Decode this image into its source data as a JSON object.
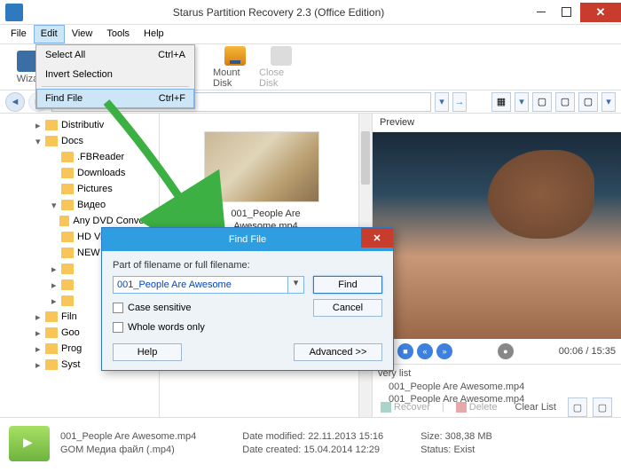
{
  "window": {
    "title": "Starus Partition Recovery 2.3 (Office Edition)"
  },
  "menu": {
    "file": "File",
    "edit": "Edit",
    "view": "View",
    "tools": "Tools",
    "help": "Help"
  },
  "edit_menu": {
    "select_all": "Select All",
    "select_all_sc": "Ctrl+A",
    "invert": "Invert Selection",
    "find": "Find File",
    "find_sc": "Ctrl+F"
  },
  "toolbar": {
    "wizard": "Wiza",
    "mount": "Mount Disk",
    "close_disk": "Close Disk"
  },
  "tree": {
    "items": [
      {
        "label": "Distributiv",
        "ind": "ind2",
        "exp": "▸"
      },
      {
        "label": "Docs",
        "ind": "ind2",
        "exp": "▾"
      },
      {
        "label": ".FBReader",
        "ind": "ind3",
        "exp": ""
      },
      {
        "label": "Downloads",
        "ind": "ind3",
        "exp": ""
      },
      {
        "label": "Pictures",
        "ind": "ind3",
        "exp": ""
      },
      {
        "label": "Видео",
        "ind": "ind3",
        "exp": "▾"
      },
      {
        "label": "Any DVD Converter",
        "ind": "ind3",
        "exp": ""
      },
      {
        "label": "HD Video good",
        "ind": "ind3",
        "exp": ""
      },
      {
        "label": "NEW clip",
        "ind": "ind3",
        "exp": ""
      },
      {
        "label": "",
        "ind": "ind3",
        "exp": "▸"
      },
      {
        "label": "",
        "ind": "ind3",
        "exp": "▸"
      },
      {
        "label": "",
        "ind": "ind3",
        "exp": "▸"
      },
      {
        "label": "Filn",
        "ind": "ind2",
        "exp": "▸"
      },
      {
        "label": "Goo",
        "ind": "ind2",
        "exp": "▸"
      },
      {
        "label": "Prog",
        "ind": "ind2",
        "exp": "▸"
      },
      {
        "label": "Syst",
        "ind": "ind2",
        "exp": "▸"
      }
    ]
  },
  "file": {
    "thumb_label_l1": "001_People Are",
    "thumb_label_l2": "Awesome.mp4"
  },
  "preview": {
    "title": "Preview"
  },
  "media": {
    "time": "00:06 / 15:35"
  },
  "recovery": {
    "title": "very list",
    "items": [
      "001_People Are Awesome.mp4",
      "001_People Are Awesome.mp4"
    ]
  },
  "actions": {
    "recover": "Recover",
    "delete": "Delete",
    "clear": "Clear List"
  },
  "info": {
    "filename": "001_People Are Awesome.mp4",
    "filetype": "GOM Медиа файл (.mp4)",
    "modified_label": "Date modified:",
    "modified": "22.11.2013 15:16",
    "created_label": "Date created:",
    "created": "15.04.2014 12:29",
    "size_label": "Size:",
    "size": "308,38 MB",
    "status_label": "Status:",
    "status": "Exist"
  },
  "dialog": {
    "title": "Find File",
    "label": "Part of filename or full filename:",
    "value": "001_People Are Awesome",
    "case": "Case sensitive",
    "whole": "Whole words only",
    "find": "Find",
    "cancel": "Cancel",
    "help": "Help",
    "advanced": "Advanced >>"
  }
}
